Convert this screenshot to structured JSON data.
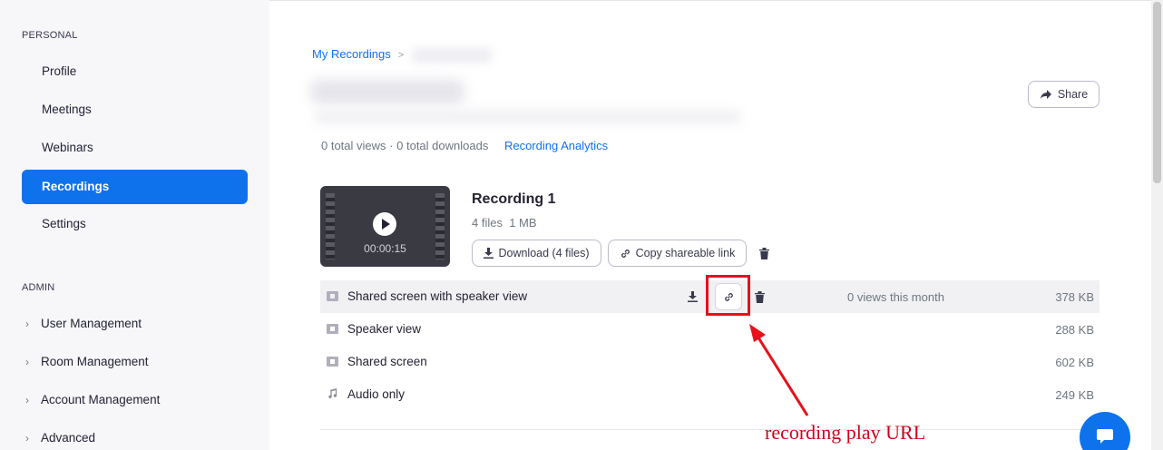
{
  "sidebar": {
    "personal_title": "PERSONAL",
    "personal_items": [
      "Profile",
      "Meetings",
      "Webinars",
      "Recordings",
      "Settings"
    ],
    "admin_title": "ADMIN",
    "admin_items": [
      "User Management",
      "Room Management",
      "Account Management",
      "Advanced"
    ]
  },
  "breadcrumb": {
    "root": "My Recordings",
    "sep": ">"
  },
  "share_label": "Share",
  "stats": {
    "views": "0 total views",
    "dot": "·",
    "downloads": "0 total downloads",
    "analytics": "Recording Analytics"
  },
  "recording": {
    "title": "Recording 1",
    "files": "4 files",
    "size": "1 MB",
    "duration": "00:00:15",
    "download_label": "Download (4 files)",
    "copy_label": "Copy shareable link"
  },
  "files": [
    {
      "name": "Shared screen with speaker view",
      "views": "0 views this month",
      "size": "378 KB",
      "icon": "video-file-icon"
    },
    {
      "name": "Speaker view",
      "size": "288 KB",
      "icon": "video-file-icon"
    },
    {
      "name": "Shared screen",
      "size": "602 KB",
      "icon": "video-file-icon"
    },
    {
      "name": "Audio only",
      "size": "249 KB",
      "icon": "music-note-icon"
    }
  ],
  "annotation": "recording play URL",
  "colors": {
    "accent": "#0e72ed",
    "annotation": "#d0021b"
  }
}
